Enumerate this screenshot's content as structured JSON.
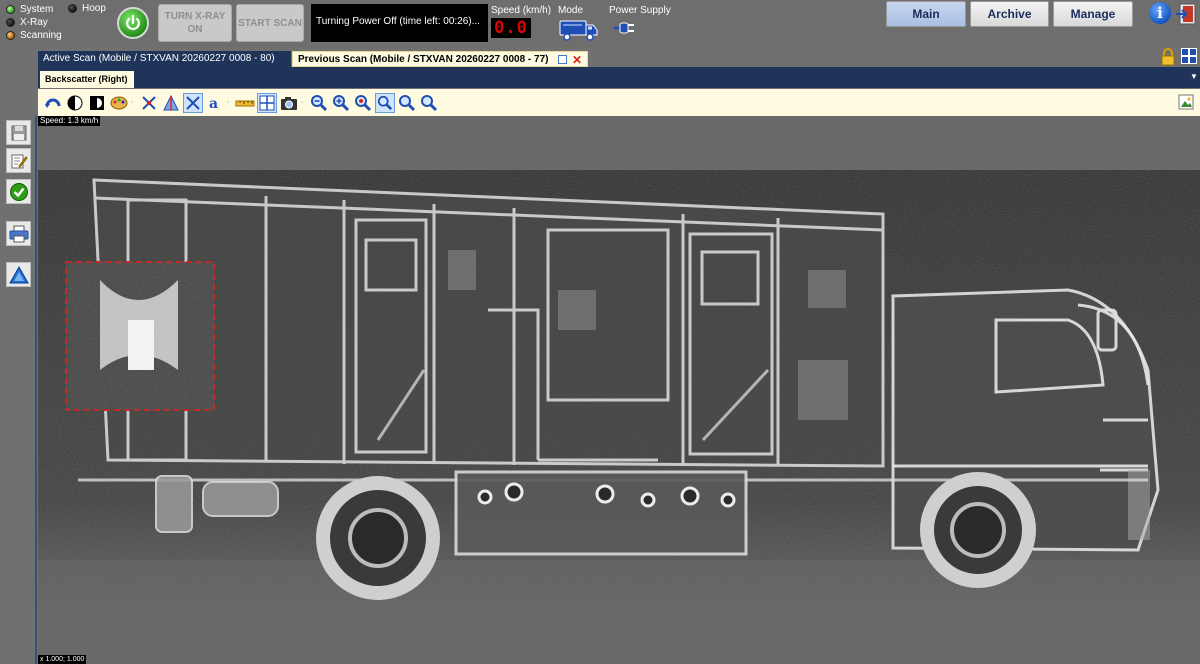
{
  "status": {
    "system": "System",
    "xray": "X-Ray",
    "scanning": "Scanning",
    "hoop": "Hoop"
  },
  "controls": {
    "turn_xray_line1": "TURN X-RAY",
    "turn_xray_line2": "ON",
    "start_scan": "START SCAN",
    "message": "Turning Power Off (time left: 00:26)..."
  },
  "speed": {
    "label": "Speed (km/h)",
    "value": "0.0"
  },
  "mode": {
    "label": "Mode",
    "icon": "mobile-van-icon"
  },
  "power_supply": {
    "label": "Power Supply",
    "icon": "power-plug-icon"
  },
  "nav": {
    "main": "Main",
    "archive": "Archive",
    "manage": "Manage",
    "active": "Main"
  },
  "tabs": {
    "active_scan": "Active Scan (Mobile / STXVAN 20260227 0008 - 80)",
    "previous_scan": "Previous Scan (Mobile / STXVAN 20260227 0008 - 77)"
  },
  "viewer": {
    "sub_tab": "Backscatter (Right)",
    "speed_overlay": "Speed: 1.3 km/h",
    "zoom_overlay": "x 1.000; 1.000"
  },
  "colors": {
    "header_navy": "#20345a",
    "toolbar_cream": "#fffbe1",
    "speed_red": "#e00000",
    "power_green": "#2e9d17"
  },
  "toolbar_icons": [
    "rotate-icon",
    "contrast-icon",
    "invert-icon",
    "palette-icon",
    "edge-enhance-icon",
    "histogram-icon",
    "crosshair-icon",
    "text-annotation-icon",
    "ruler-icon",
    "grid-icon",
    "camera-icon",
    "zoom-out-icon",
    "zoom-in-icon",
    "zoom-region-icon",
    "zoom-fit-icon",
    "zoom-window-icon",
    "zoom-reset-icon"
  ],
  "sidebar_icons": [
    "save-icon",
    "edit-icon",
    "approve-icon",
    "print-icon",
    "triangle-icon"
  ]
}
